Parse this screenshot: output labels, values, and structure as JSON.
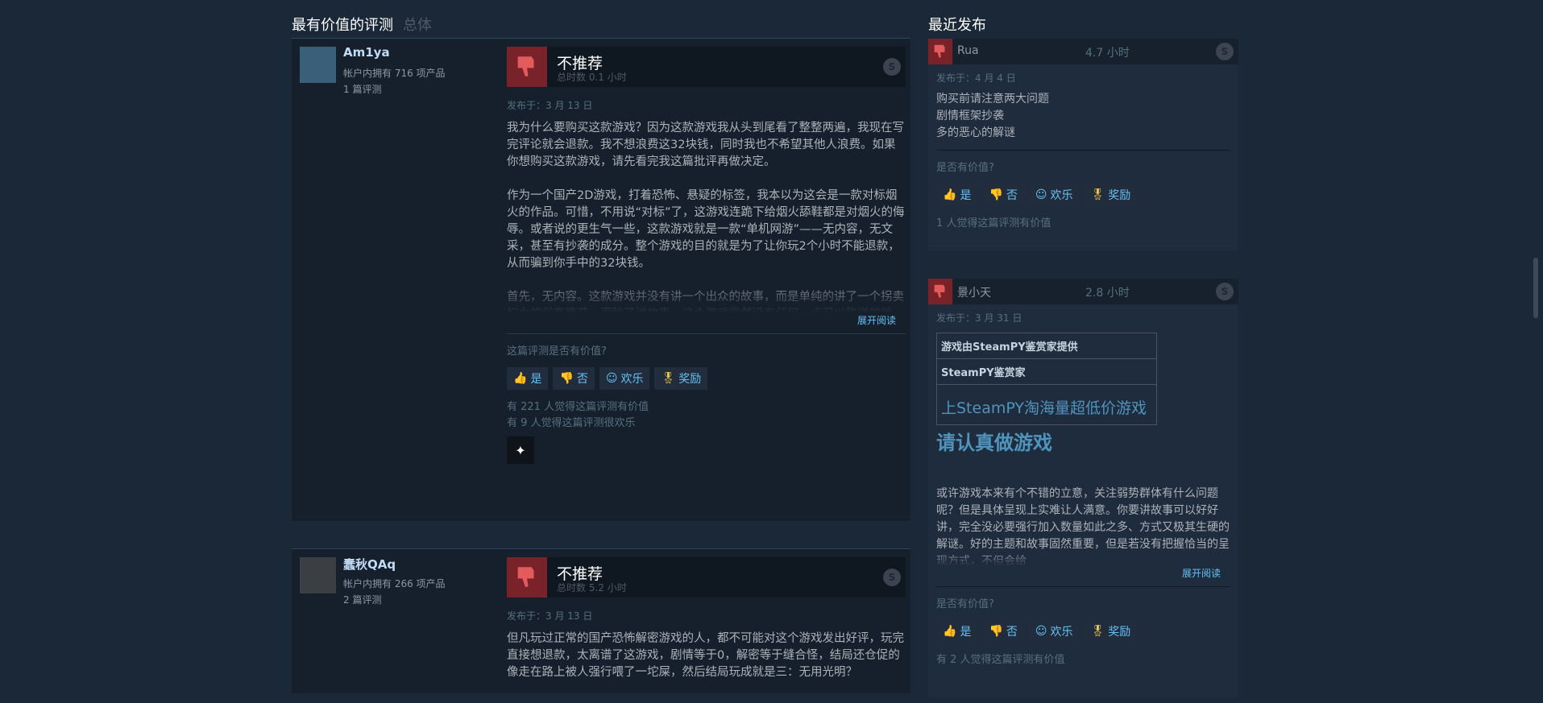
{
  "left": {
    "title": "最有价值的评测",
    "subtitle": "总体",
    "reviews": [
      {
        "name": "Am1ya",
        "products": "帐户内拥有 716 项产品",
        "reviews": "1 篇评测",
        "verdict": "不推荐",
        "hours": "总时数 0.1 小时",
        "date": "发布于：3 月 13 日",
        "body": "我为什么要购买这款游戏？因为这款游戏我从头到尾看了整整两遍，我现在写完评论就会退款。我不想浪费这32块钱，同时我也不希望其他人浪费。如果你想购买这款游戏，请先看完我这篇批评再做决定。\n\n作为一个国产2D游戏，打着恐怖、悬疑的标签，我本以为这会是一款对标烟火的作品。可惜，不用说“对标”了，这游戏连跪下给烟火舔鞋都是对烟火的侮辱。或者说的更生气一些，这款游戏就是一款“单机网游”——无内容，无文采，甚至有抄袭的成分。整个游戏的目的就是为了让你玩2个小时不能退款，从而骗到你手中的32块钱。\n\n首先，无内容。这款游戏并没有讲一个出众的故事，而是单纯的讲了一个拐卖妇女的俗套情节。而除了讲故事，这个游戏竟然没有任何一点可以称道的地方。",
        "expand": "展开阅读",
        "question": "这篇评测是否有价值?",
        "yes": "是",
        "no": "否",
        "funny": "欢乐",
        "award": "奖励",
        "helpful": "有 221 人觉得这篇评测有价值",
        "funny_count": "有 9 人觉得这篇评测很欢乐"
      },
      {
        "name": "蠢秋QAq",
        "products": "帐户内拥有 266 项产品",
        "reviews": "2 篇评测",
        "verdict": "不推荐",
        "hours": "总时数 5.2 小时",
        "date": "发布于：3 月 13 日",
        "body": "但凡玩过正常的国产恐怖解密游戏的人，都不可能对这个游戏发出好评，玩完直接想退款，太离谱了这游戏，剧情等于0，解密等于缝合怪，结局还仓促的像走在路上被人强行喂了一坨屎，然后结局玩成就是三：无用光明？"
      }
    ]
  },
  "right": {
    "title": "最近发布",
    "reviews": [
      {
        "name": "Rua",
        "hours": "4.7 小时",
        "date": "发布于：4 月 4 日",
        "body": "购买前请注意两大问题\n剧情框架抄袭\n多的恶心的解谜",
        "question": "是否有价值?",
        "yes": "是",
        "no": "否",
        "funny": "欢乐",
        "award": "奖励",
        "helpful": "1 人觉得这篇评测有价值"
      },
      {
        "name": "景小天",
        "hours": "2.8 小时",
        "date": "发布于：3 月 31 日",
        "table": [
          "游戏由SteamPY鉴赏家提供",
          "SteamPY鉴赏家",
          "上SteamPY淘海量超低价游戏"
        ],
        "heading": "请认真做游戏",
        "body": "或许游戏本来有个不错的立意，关注弱势群体有什么问题呢？但是具体呈现上实难让人满意。你要讲故事可以好好讲，完全没必要强行加入数量如此之多、方式又极其生硬的解谜。好的主题和故事固然重要，但是若没有把握恰当的呈现方式，不但会给",
        "expand": "展开阅读",
        "question": "是否有价值?",
        "yes": "是",
        "no": "否",
        "funny": "欢乐",
        "award": "奖励",
        "helpful": "有 2 人觉得这篇评测有价值"
      }
    ]
  }
}
